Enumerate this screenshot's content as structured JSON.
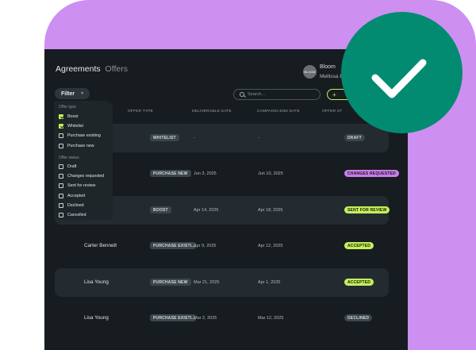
{
  "header": {
    "tab_active": "Agreements",
    "tab_other": "Offers",
    "brand_logo_text": "BLOOM",
    "brand_name": "Bloom",
    "user_name": "Mellissa B"
  },
  "toolbar": {
    "filter_label": "Filter",
    "search_placeholder": "Search...",
    "add_label": "+"
  },
  "columns": {
    "offer_type": "OFFER TYPE",
    "deliverable_date": "DELIVERABLE DATE",
    "campaign_end_date": "CAMPAIGN END DATE",
    "offer_status": "OFFER ST"
  },
  "rows": [
    {
      "name": "",
      "type": "WHITELIST",
      "deliverable": "-",
      "end": "-",
      "status": "DRAFT"
    },
    {
      "name": "",
      "type": "PURCHASE NEW",
      "deliverable": "Jun 3, 2025",
      "end": "Jun 10, 2025",
      "status": "CHANGES REQUESTED"
    },
    {
      "name": "",
      "type": "BOOST",
      "deliverable": "Apr 14, 2025",
      "end": "Apr 18, 2025",
      "status": "SENT FOR REVIEW"
    },
    {
      "name": "Carter Bennett",
      "type": "PURCHASE EXISTI...",
      "deliverable": "Apr 9, 2025",
      "end": "Apr 12, 2025",
      "status": "ACCEPTED"
    },
    {
      "name": "Lisa Young",
      "type": "PURCHASE NEW",
      "deliverable": "Mar 21, 2025",
      "end": "Apr 1, 2025",
      "status": "ACCEPTED"
    },
    {
      "name": "Lisa Young",
      "type": "PURCHASE EXISTI...",
      "deliverable": "Mar 2, 2025",
      "end": "Mar 12, 2025",
      "status": "DECLINED"
    }
  ],
  "filter_menu": {
    "offer_type_heading": "Offer type",
    "offer_type_options": [
      {
        "label": "Boost",
        "checked": true
      },
      {
        "label": "Whitelist",
        "checked": true
      },
      {
        "label": "Purchase existing",
        "checked": false
      },
      {
        "label": "Purchase new",
        "checked": false
      }
    ],
    "offer_status_heading": "Offer status",
    "offer_status_options": [
      {
        "label": "Draft",
        "checked": false
      },
      {
        "label": "Changes requested",
        "checked": false
      },
      {
        "label": "Sent for review",
        "checked": false
      },
      {
        "label": "Accepted",
        "checked": false
      },
      {
        "label": "Declined",
        "checked": false
      },
      {
        "label": "Cancelled",
        "checked": false
      }
    ]
  },
  "colors": {
    "accent_green": "#c3ef5b",
    "accent_purple": "#c97ee8",
    "badge_green": "#038b72",
    "background_purple": "#cd8ff0"
  },
  "icons": {
    "search": "search-icon",
    "chevron": "chevron-down-icon",
    "success": "checkmark-icon"
  }
}
